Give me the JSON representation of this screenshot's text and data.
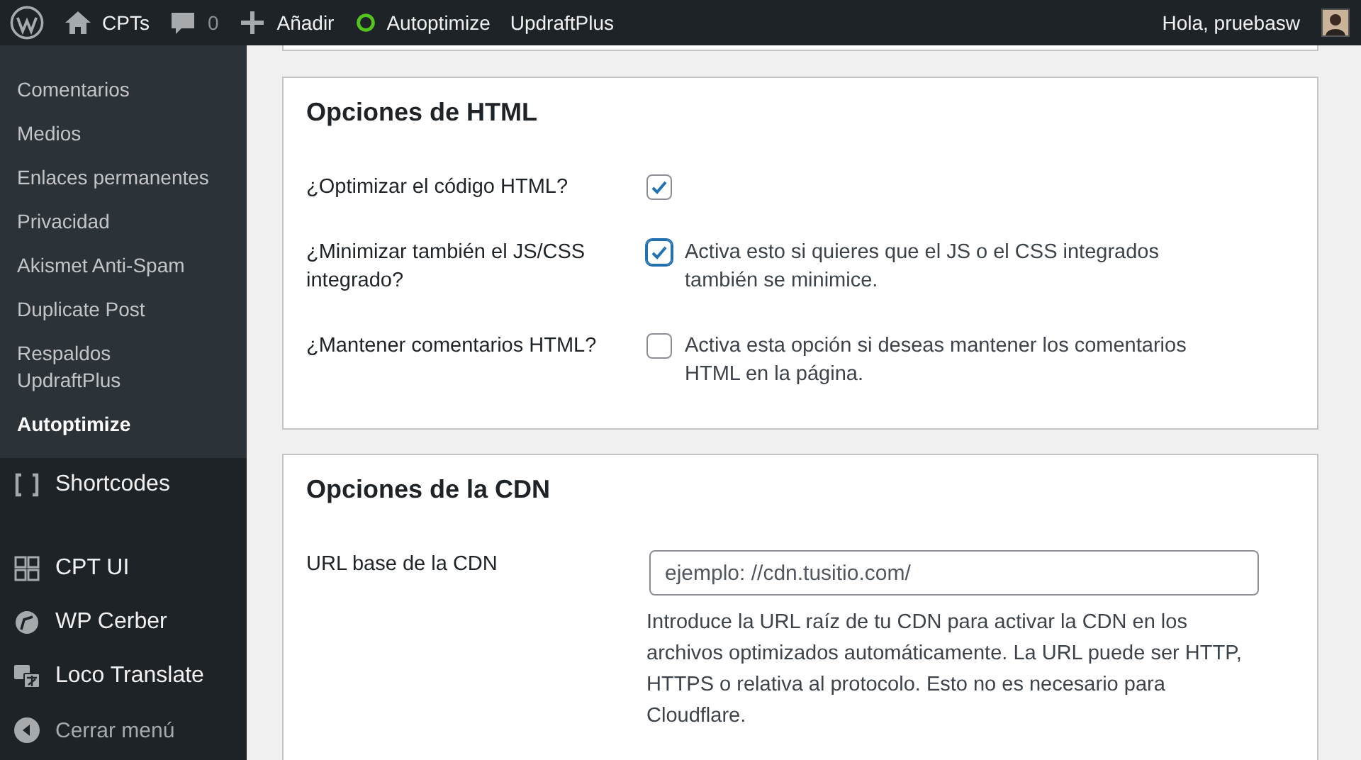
{
  "admin_bar": {
    "site": "CPTs",
    "comments": "0",
    "new": "Añadir",
    "plugins": [
      {
        "label": "Autoptimize",
        "status_icon": true
      },
      {
        "label": "UpdraftPlus",
        "status_icon": false
      }
    ],
    "greeting": "Hola, pruebasw"
  },
  "sidebar": {
    "submenu": [
      {
        "label": "Comentarios",
        "selected": false
      },
      {
        "label": "Medios",
        "selected": false
      },
      {
        "label": "Enlaces permanentes",
        "selected": false
      },
      {
        "label": "Privacidad",
        "selected": false
      },
      {
        "label": "Akismet Anti-Spam",
        "selected": false
      },
      {
        "label": "Duplicate Post",
        "selected": false
      },
      {
        "label": "Respaldos UpdraftPlus",
        "selected": false
      },
      {
        "label": "Autoptimize",
        "selected": true
      }
    ],
    "menu": [
      {
        "label": "Shortcodes",
        "kind": "brackets"
      },
      {
        "label": "CPT UI",
        "kind": "grid"
      },
      {
        "label": "WP Cerber",
        "kind": "shield"
      },
      {
        "label": "Loco Translate",
        "kind": "translate"
      },
      {
        "label": "Cerrar menú",
        "kind": "collapse"
      }
    ]
  },
  "sections": [
    {
      "title": "Opciones de HTML",
      "rows": [
        {
          "kind": "checkbox",
          "label": "¿Optimizar el código HTML?",
          "checked": true
        },
        {
          "kind": "checkbox",
          "label": "¿Minimizar también el JS/CSS integrado?",
          "checked": true,
          "focused": true,
          "description": "Activa esto si quieres que el JS o el CSS integrados también se minimice."
        },
        {
          "kind": "checkbox",
          "label": "¿Mantener comentarios HTML?",
          "checked": false,
          "description": "Activa esta opción si deseas mantener los comentarios HTML en la página."
        }
      ]
    },
    {
      "title": "Opciones de la CDN",
      "rows": [
        {
          "kind": "text",
          "label": "URL base de la CDN",
          "placeholder": "ejemplo: //cdn.tusitio.com/",
          "description": "Introduce la URL raíz de tu CDN para activar la CDN en los archivos optimizados automáticamente. La URL puede ser HTTP, HTTPS o relativa al protocolo. Esto no es necesario para Cloudflare."
        }
      ]
    }
  ]
}
